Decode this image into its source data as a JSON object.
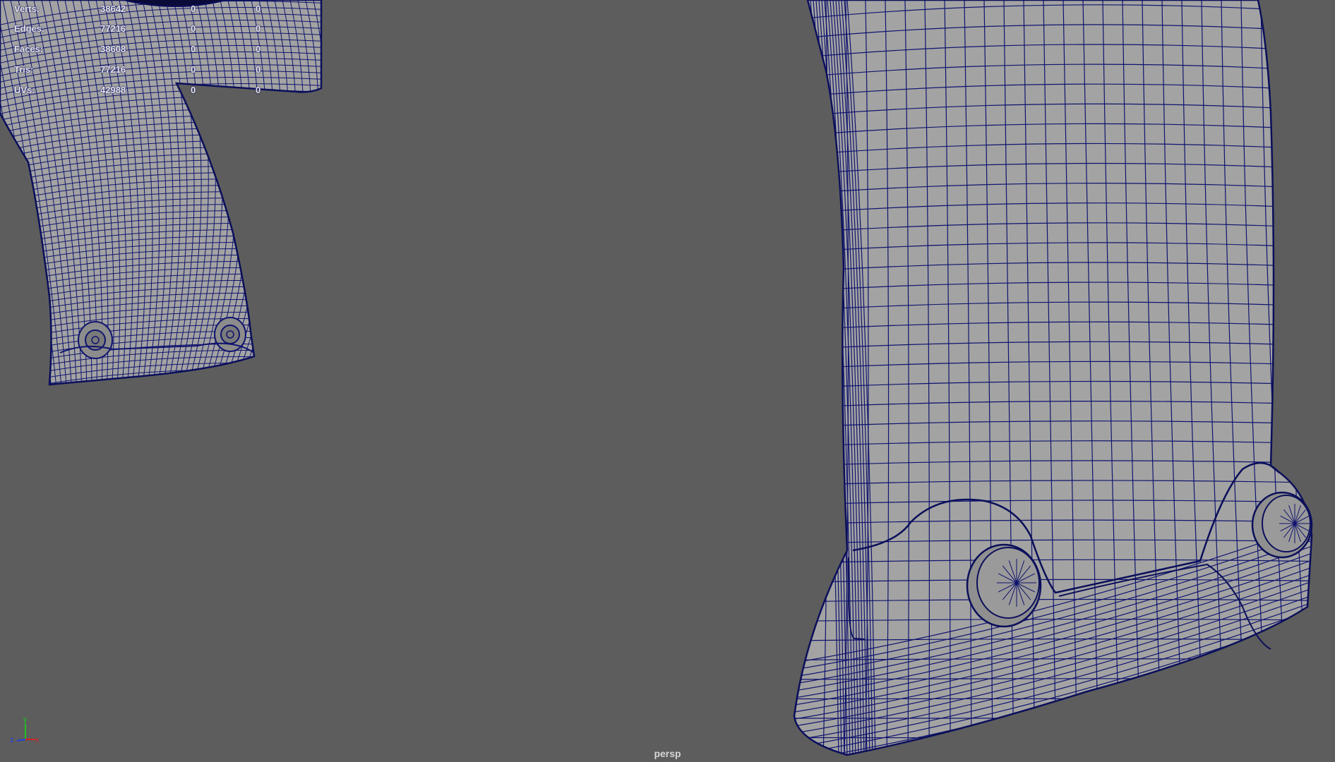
{
  "viewport": {
    "camera_label": "persp",
    "background_color": "#5d5d5d",
    "mesh_fill_color": "#a3a3a3",
    "wire_color": "#10146e"
  },
  "hud": {
    "rows": [
      {
        "label": "Verts:",
        "total": "38642",
        "selected": "0",
        "components": "0"
      },
      {
        "label": "Edges:",
        "total": "77216",
        "selected": "0",
        "components": "0"
      },
      {
        "label": "Faces:",
        "total": "38608",
        "selected": "0",
        "components": "0"
      },
      {
        "label": "Tris:",
        "total": "77216",
        "selected": "0",
        "components": "0"
      },
      {
        "label": "UVs:",
        "total": "42988",
        "selected": "0",
        "components": "0"
      }
    ]
  },
  "axis_gizmo": {
    "y_label": "y",
    "z_label": "z",
    "x_label": "x",
    "x_color": "#d22020",
    "y_color": "#20c020",
    "z_color": "#2040e0"
  }
}
